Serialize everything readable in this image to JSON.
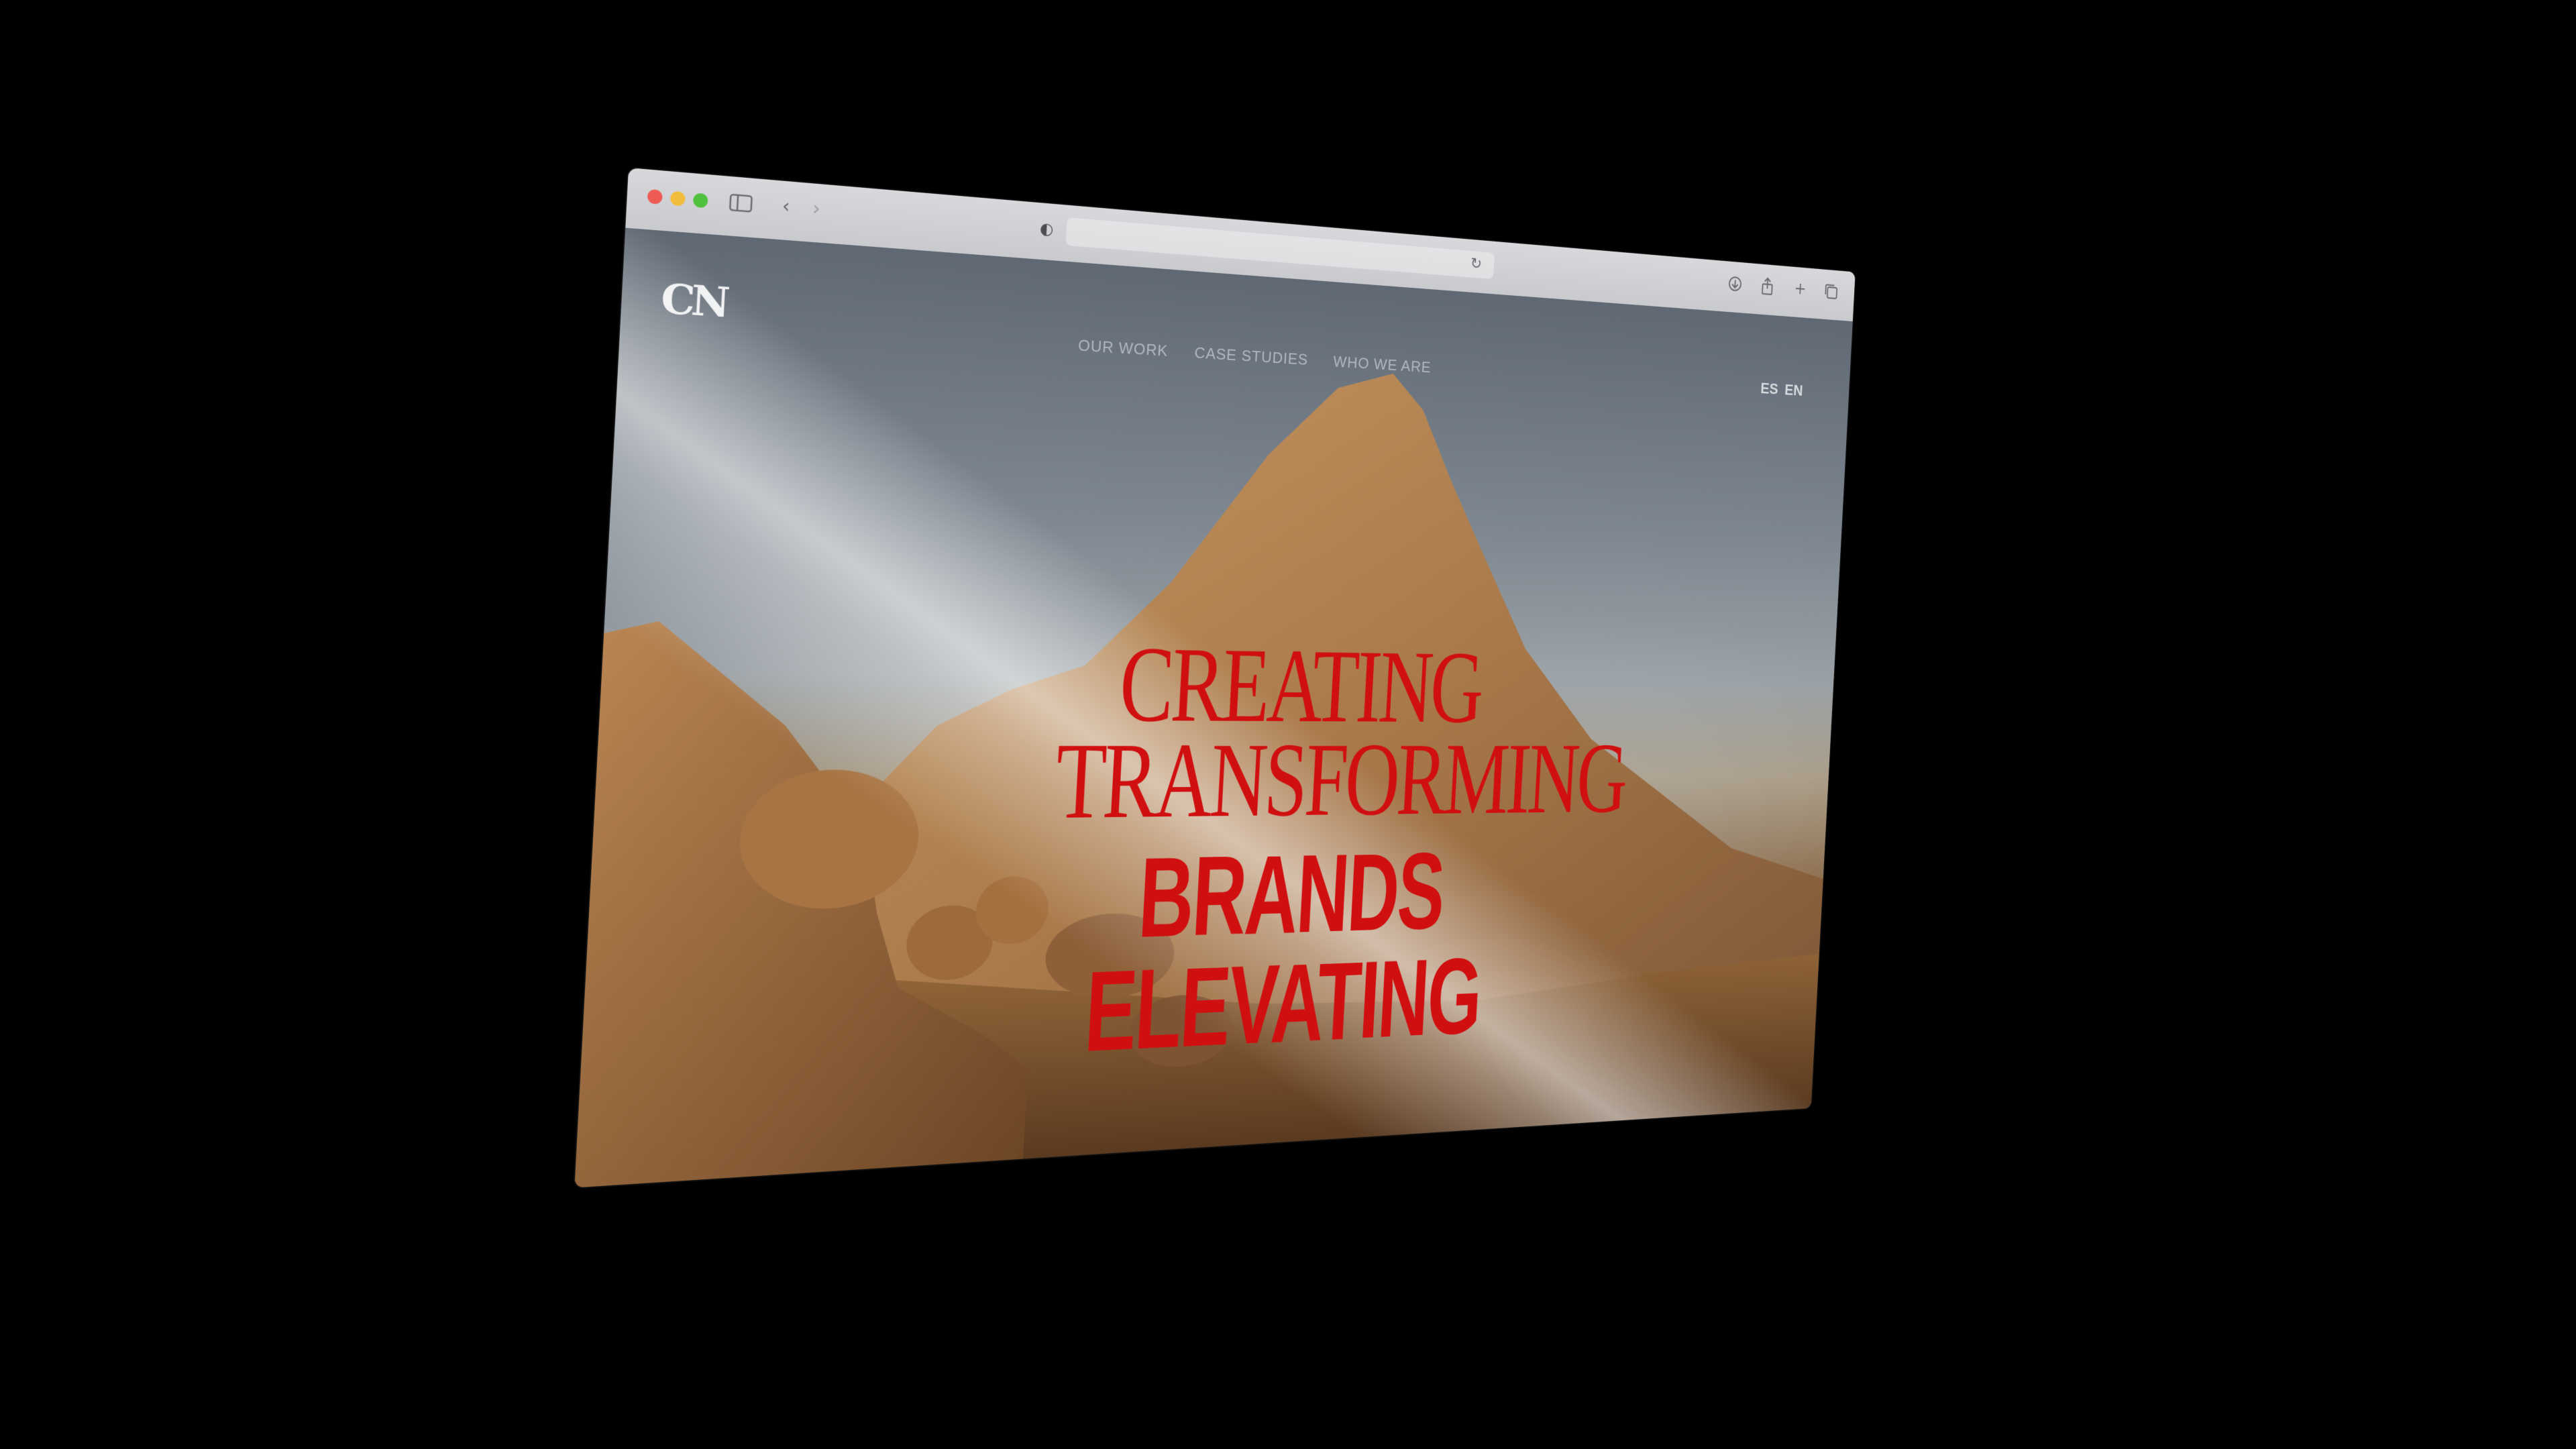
{
  "browser": {
    "controls": {
      "sidebar_icon": "sidebar-icon",
      "back_icon": "chevron-left-icon",
      "forward_icon": "chevron-right-icon",
      "privacy_icon": "privacy-shield-icon",
      "reload_icon": "reload-icon",
      "download_icon": "download-icon",
      "share_icon": "share-icon",
      "new_tab_icon": "plus-icon",
      "tabs_icon": "tab-overview-icon"
    }
  },
  "site": {
    "logo": "CN",
    "nav": [
      "OUR WORK",
      "CASE STUDIES",
      "WHO WE ARE"
    ],
    "languages": [
      "ES",
      "EN"
    ],
    "hero": [
      "CREATING",
      "TRANSFORMING",
      "BRANDS",
      "ELEVATING"
    ]
  },
  "colors": {
    "hero_text": "#d01010",
    "traffic_red": "#ee5b55",
    "traffic_yellow": "#f2bd3d",
    "traffic_green": "#50c13f"
  }
}
